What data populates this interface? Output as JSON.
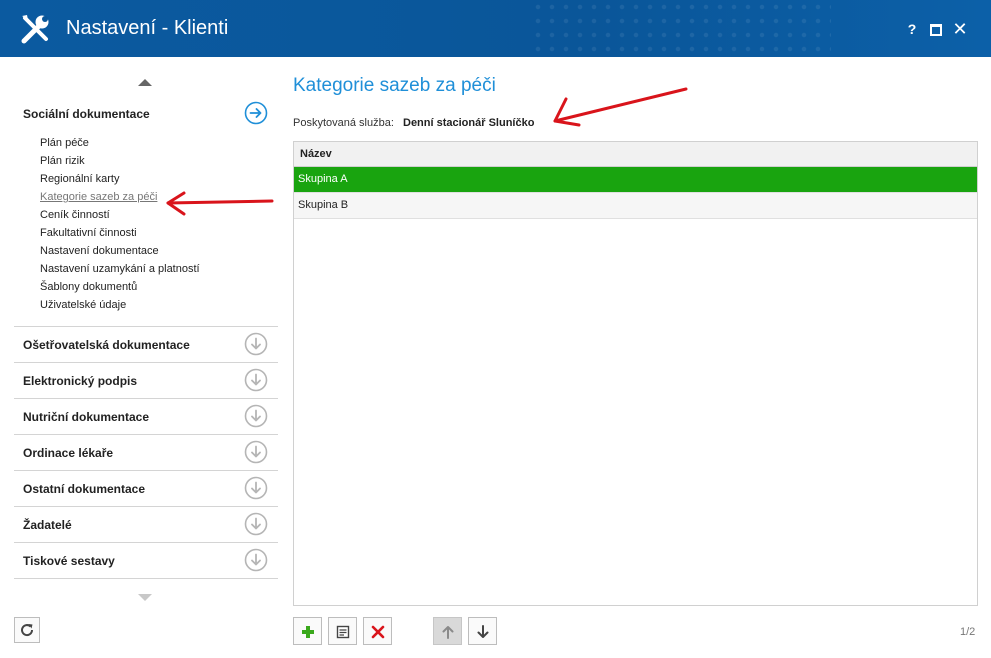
{
  "window": {
    "title": "Nastavení - Klienti",
    "help_label": "?",
    "close_label": "✕"
  },
  "sidebar": {
    "expanded_section": {
      "label": "Sociální dokumentace",
      "items": [
        {
          "label": "Plán péče"
        },
        {
          "label": "Plán rizik"
        },
        {
          "label": "Regionální karty"
        },
        {
          "label": "Kategorie sazeb za péči",
          "active": true
        },
        {
          "label": "Ceník činností"
        },
        {
          "label": "Fakultativní činnosti"
        },
        {
          "label": "Nastavení dokumentace"
        },
        {
          "label": "Nastavení uzamykání a platností"
        },
        {
          "label": "Šablony dokumentů"
        },
        {
          "label": "Uživatelské údaje"
        }
      ]
    },
    "sections": [
      {
        "label": "Ošetřovatelská dokumentace"
      },
      {
        "label": "Elektronický podpis"
      },
      {
        "label": "Nutriční dokumentace"
      },
      {
        "label": "Ordinace lékaře"
      },
      {
        "label": "Ostatní dokumentace"
      },
      {
        "label": "Žadatelé"
      },
      {
        "label": "Tiskové sestavy"
      }
    ]
  },
  "main": {
    "title": "Kategorie sazeb za péči",
    "service_label": "Poskytovaná služba:",
    "service_value": "Denní stacionář Sluníčko",
    "grid": {
      "column_header": "Název",
      "rows": [
        {
          "label": "Skupina A",
          "selected": true
        },
        {
          "label": "Skupina B",
          "selected": false
        }
      ]
    },
    "pager": "1/2"
  },
  "colors": {
    "titlebar": "#0a5699",
    "accent": "#1f8fd8",
    "selected_row": "#19a40f",
    "annotation_arrow": "#d9141b"
  },
  "icons": {
    "app": "wrench-screwdriver-icon",
    "expanded": "arrow-right-circle-icon",
    "collapsed": "arrow-down-circle-icon",
    "refresh": "refresh-icon",
    "add": "plus-icon",
    "edit": "document-edit-icon",
    "delete": "x-icon",
    "move_up": "arrow-up-icon",
    "move_down": "arrow-down-icon"
  }
}
